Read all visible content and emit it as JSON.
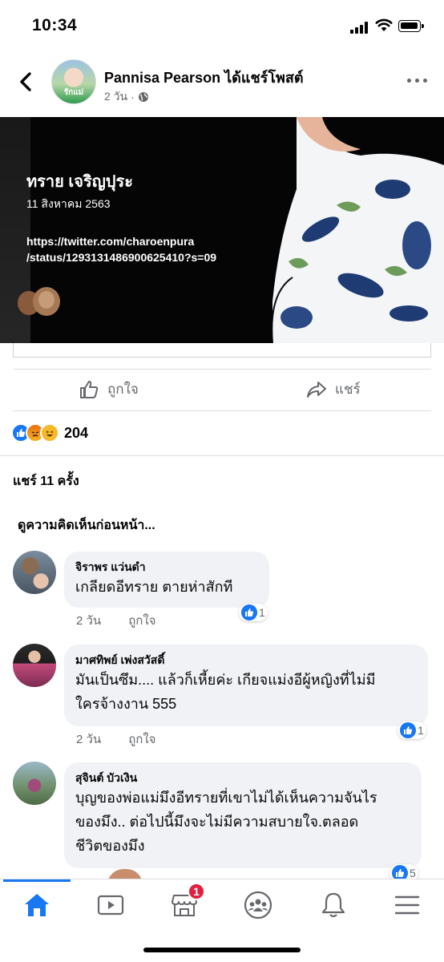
{
  "status_bar": {
    "time": "10:34"
  },
  "post": {
    "poster_name": "Pannisa Pearson",
    "action": "ได้แชร์โพสต์",
    "time_ago": "2 วัน",
    "avatar_badge": "รักแม่"
  },
  "shared_image": {
    "name": "ทราย เจริญปุระ",
    "date": "11 สิงหาคม 2563",
    "url_line1": "https://twitter.com/charoenpura",
    "url_line2": "/status/1293131486900625410?s=09"
  },
  "actions": {
    "like_label": "ถูกใจ",
    "share_label": "แชร์"
  },
  "reactions": {
    "count": "204",
    "types": [
      "like",
      "angry",
      "haha"
    ]
  },
  "share_count": "แชร์ 11 ครั้ง",
  "previous_comments_label": "ดูความคิดเห็นก่อนหน้า...",
  "comments": [
    {
      "name": "จิราพร แว่นดำ",
      "lines": [
        "เกลียดอีทราย ตายห่าสักที"
      ],
      "time": "2 วัน",
      "like_label": "ถูกใจ",
      "likes": "1"
    },
    {
      "name": "มาศทิพย์ เพ่งสวัสดิ์",
      "lines": [
        "มันเป็นซึม.... แล้วก็เหี้ยค่ะ เกียจแม่งอีผู้หญิงที่ไม่มี",
        "ใครจ้างงาน 555"
      ],
      "time": "2 วัน",
      "like_label": "ถูกใจ",
      "likes": "1"
    },
    {
      "name": "สุจินต์ บัวเงิน",
      "lines": [
        "บุญของพ่อแม่มึงอีทรายที่เขาไม่ได้เห็นความจันไร",
        "ของมึง.. ต่อไปนี้มึงจะไม่มีความสบายใจ.ตลอด",
        "ชีวิตของมึง"
      ],
      "likes": "5"
    }
  ],
  "tab_bar": {
    "tabs": [
      "home",
      "watch",
      "marketplace",
      "groups",
      "notifications",
      "menu"
    ],
    "marketplace_badge": "1"
  },
  "colors": {
    "accent": "#1877f2",
    "badge": "#e41e3f",
    "bubble": "#f0f2f5",
    "muted": "#65676b"
  }
}
